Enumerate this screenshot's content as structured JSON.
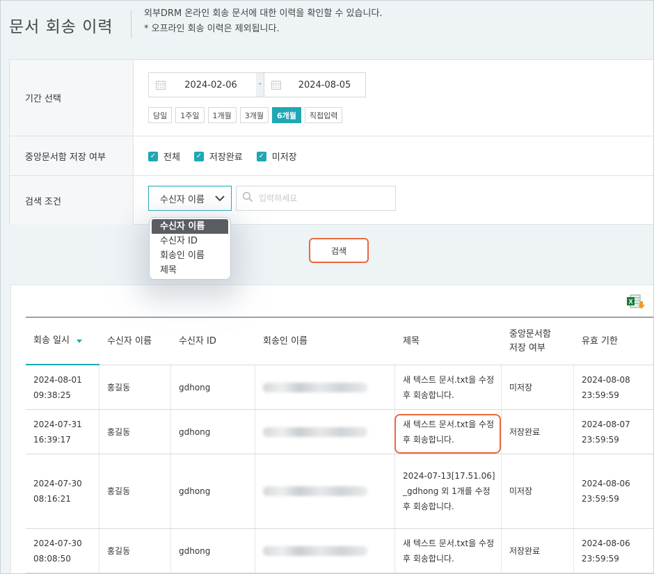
{
  "header": {
    "title": "문서 회송 이력",
    "desc_line1": "외부DRM 온라인 회송 문서에 대한 이력을 확인할 수 있습니다.",
    "desc_line2": "* 오프라인 회송 이력은 제외됩니다."
  },
  "filter": {
    "period_label": "기간 선택",
    "date_from": "2024-02-06",
    "date_sep": "-",
    "date_to": "2024-08-05",
    "quick_ranges": [
      "당일",
      "1주일",
      "1개월",
      "3개월",
      "6개월",
      "직접입력"
    ],
    "active_range": "6개월",
    "storage_label": "중앙문서함 저장 여부",
    "storage_options": [
      "전체",
      "저장완료",
      "미저장"
    ],
    "condition_label": "검색 조건",
    "condition_selected": "수신자 이름",
    "condition_options": [
      "수신자 이름",
      "수신자 ID",
      "회송인 이름",
      "제목"
    ],
    "search_placeholder": "입력하세요"
  },
  "search_button": "검색",
  "accent_color": "#1fa7b3",
  "highlight_color": "#e8683e",
  "table": {
    "columns": [
      "회송 일시",
      "수신자 이름",
      "수신자 ID",
      "회송인 이름",
      "제목",
      "중앙문서함\n저장 여부",
      "유효 기한"
    ],
    "sorted_column": "회송 일시",
    "rows": [
      {
        "date": "2024-08-01\n09:38:25",
        "recipient": "홍길동",
        "id": "gdhong",
        "sender": "",
        "title": "새 텍스트 문서.txt을 수정 후 회송합니다.",
        "stored": "미저장",
        "expiry": "2024-08-08\n23:59:59"
      },
      {
        "date": "2024-07-31\n16:39:17",
        "recipient": "홍길동",
        "id": "gdhong",
        "sender": "",
        "title": "새 텍스트 문서.txt을 수정 후 회송합니다.",
        "stored": "저장완료",
        "expiry": "2024-08-07\n23:59:59"
      },
      {
        "date": "2024-07-30\n08:16:21",
        "recipient": "홍길동",
        "id": "gdhong",
        "sender": "",
        "title": "2024-07-13[17.51.06]_gdhong 외 1개를 수정 후 회송합니다.",
        "stored": "미저장",
        "expiry": "2024-08-06\n23:59:59"
      },
      {
        "date": "2024-07-30\n08:08:50",
        "recipient": "홍길동",
        "id": "gdhong",
        "sender": "",
        "title": "새 텍스트 문서.txt을 수정 후 회송합니다.",
        "stored": "저장완료",
        "expiry": "2024-08-06\n23:59:59"
      }
    ]
  }
}
